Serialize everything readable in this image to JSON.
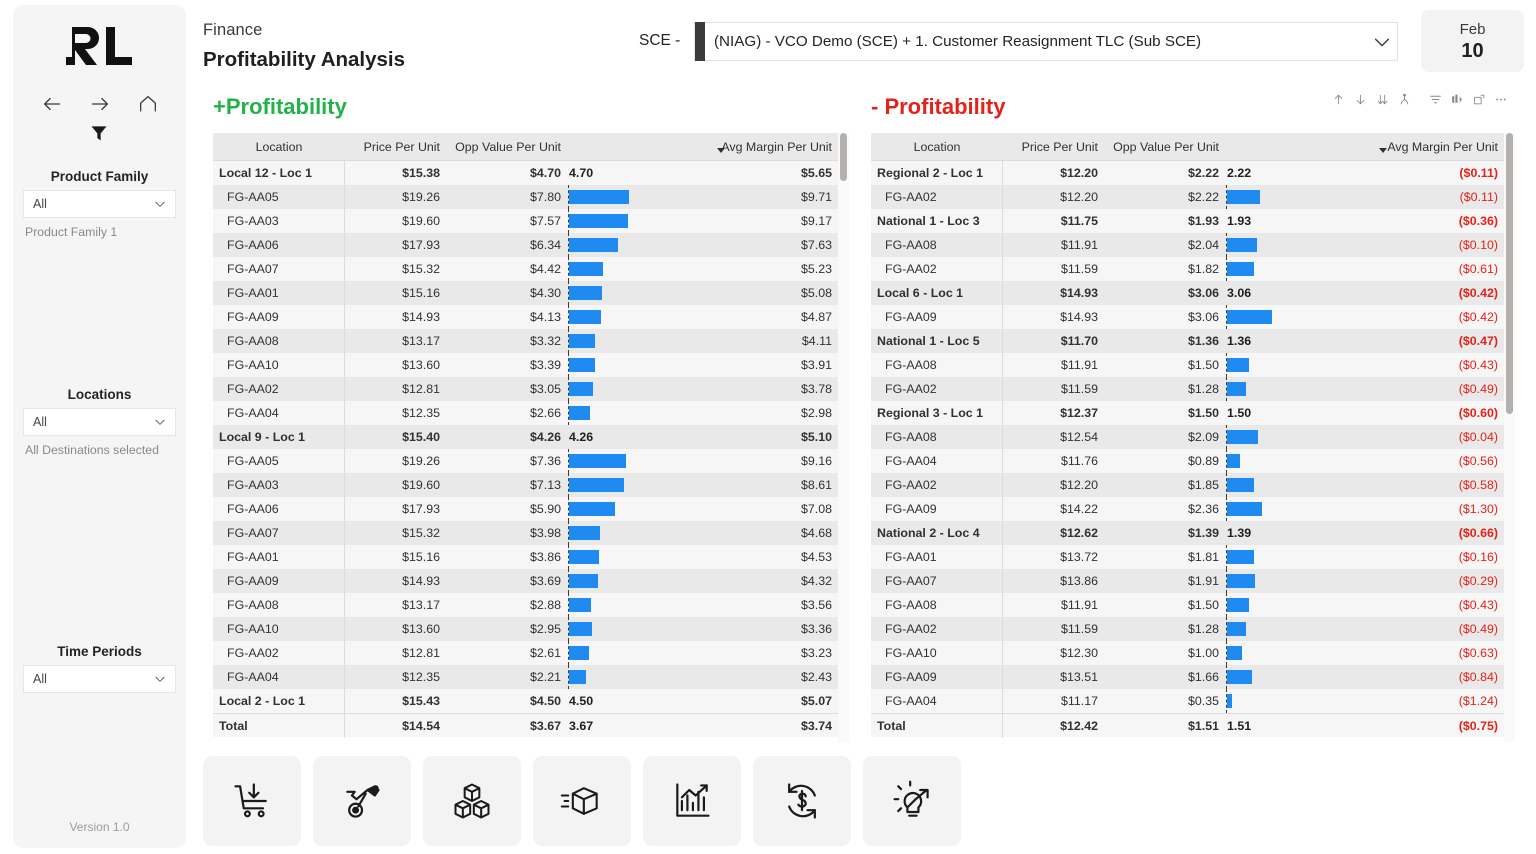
{
  "sidebar": {
    "logo_name": "rl-logo",
    "nav": [
      {
        "name": "back-icon",
        "label": "Back"
      },
      {
        "name": "forward-icon",
        "label": "Forward"
      },
      {
        "name": "home-icon",
        "label": "Home"
      }
    ],
    "filter_icon_label": "Filter",
    "slicers": [
      {
        "title": "Product Family",
        "value": "All",
        "sub": "Product Family 1"
      },
      {
        "title": "Locations",
        "value": "All",
        "sub": "All Destinations selected"
      },
      {
        "title": "Time Periods",
        "value": "All",
        "sub": ""
      }
    ],
    "version": "Version 1.0"
  },
  "header": {
    "category": "Finance",
    "title": "Profitability Analysis",
    "scenario_label": "SCE -",
    "scenario_value": "(NIAG) - VCO Demo (SCE) + 1. Customer Reasignment TLC (Sub SCE)",
    "date_month": "Feb",
    "date_day": "10"
  },
  "viz_toolbar": [
    {
      "name": "sort-ascending-icon"
    },
    {
      "name": "sort-descending-icon"
    },
    {
      "name": "drill-down-icon"
    },
    {
      "name": "expand-hierarchy-icon"
    },
    {
      "name": "filter-icon"
    },
    {
      "name": "focus-mode-icon"
    },
    {
      "name": "expand-icon"
    },
    {
      "name": "more-options-icon"
    }
  ],
  "colors": {
    "positive": "#21b34a",
    "negative": "#e2231a",
    "bar": "#1f8bf0",
    "header_bg": "#e9e9e9"
  },
  "columns": [
    "Location",
    "Price Per Unit",
    "Opp Value Per Unit",
    "",
    "Avg Margin Per Unit"
  ],
  "panels": [
    {
      "title": "+Profitability",
      "tone": "pos",
      "bar_max": 8.0,
      "rows": [
        {
          "type": "group",
          "location": "Local 12 - Loc 1",
          "ppu": "$15.38",
          "opv": "$4.70",
          "bar_label": "4.70",
          "amp": "$5.65",
          "neg": false
        },
        {
          "type": "item",
          "location": "FG-AA05",
          "ppu": "$19.26",
          "opv": "$7.80",
          "bar": 7.8,
          "amp": "$9.71",
          "neg": false
        },
        {
          "type": "item",
          "location": "FG-AA03",
          "ppu": "$19.60",
          "opv": "$7.57",
          "bar": 7.57,
          "amp": "$9.17",
          "neg": false
        },
        {
          "type": "item",
          "location": "FG-AA06",
          "ppu": "$17.93",
          "opv": "$6.34",
          "bar": 6.34,
          "amp": "$7.63",
          "neg": false
        },
        {
          "type": "item",
          "location": "FG-AA07",
          "ppu": "$15.32",
          "opv": "$4.42",
          "bar": 4.42,
          "amp": "$5.23",
          "neg": false
        },
        {
          "type": "item",
          "location": "FG-AA01",
          "ppu": "$15.16",
          "opv": "$4.30",
          "bar": 4.3,
          "amp": "$5.08",
          "neg": false
        },
        {
          "type": "item",
          "location": "FG-AA09",
          "ppu": "$14.93",
          "opv": "$4.13",
          "bar": 4.13,
          "amp": "$4.87",
          "neg": false
        },
        {
          "type": "item",
          "location": "FG-AA08",
          "ppu": "$13.17",
          "opv": "$3.32",
          "bar": 3.32,
          "amp": "$4.11",
          "neg": false
        },
        {
          "type": "item",
          "location": "FG-AA10",
          "ppu": "$13.60",
          "opv": "$3.39",
          "bar": 3.39,
          "amp": "$3.91",
          "neg": false
        },
        {
          "type": "item",
          "location": "FG-AA02",
          "ppu": "$12.81",
          "opv": "$3.05",
          "bar": 3.05,
          "amp": "$3.78",
          "neg": false
        },
        {
          "type": "item",
          "location": "FG-AA04",
          "ppu": "$12.35",
          "opv": "$2.66",
          "bar": 2.66,
          "amp": "$2.98",
          "neg": false
        },
        {
          "type": "group",
          "location": "Local 9 - Loc 1",
          "ppu": "$15.40",
          "opv": "$4.26",
          "bar_label": "4.26",
          "amp": "$5.10",
          "neg": false
        },
        {
          "type": "item",
          "location": "FG-AA05",
          "ppu": "$19.26",
          "opv": "$7.36",
          "bar": 7.36,
          "amp": "$9.16",
          "neg": false
        },
        {
          "type": "item",
          "location": "FG-AA03",
          "ppu": "$19.60",
          "opv": "$7.13",
          "bar": 7.13,
          "amp": "$8.61",
          "neg": false
        },
        {
          "type": "item",
          "location": "FG-AA06",
          "ppu": "$17.93",
          "opv": "$5.90",
          "bar": 5.9,
          "amp": "$7.08",
          "neg": false
        },
        {
          "type": "item",
          "location": "FG-AA07",
          "ppu": "$15.32",
          "opv": "$3.98",
          "bar": 3.98,
          "amp": "$4.68",
          "neg": false
        },
        {
          "type": "item",
          "location": "FG-AA01",
          "ppu": "$15.16",
          "opv": "$3.86",
          "bar": 3.86,
          "amp": "$4.53",
          "neg": false
        },
        {
          "type": "item",
          "location": "FG-AA09",
          "ppu": "$14.93",
          "opv": "$3.69",
          "bar": 3.69,
          "amp": "$4.32",
          "neg": false
        },
        {
          "type": "item",
          "location": "FG-AA08",
          "ppu": "$13.17",
          "opv": "$2.88",
          "bar": 2.88,
          "amp": "$3.56",
          "neg": false
        },
        {
          "type": "item",
          "location": "FG-AA10",
          "ppu": "$13.60",
          "opv": "$2.95",
          "bar": 2.95,
          "amp": "$3.36",
          "neg": false
        },
        {
          "type": "item",
          "location": "FG-AA02",
          "ppu": "$12.81",
          "opv": "$2.61",
          "bar": 2.61,
          "amp": "$3.23",
          "neg": false
        },
        {
          "type": "item",
          "location": "FG-AA04",
          "ppu": "$12.35",
          "opv": "$2.21",
          "bar": 2.21,
          "amp": "$2.43",
          "neg": false
        },
        {
          "type": "group",
          "location": "Local 2 - Loc 1",
          "ppu": "$15.43",
          "opv": "$4.50",
          "bar_label": "4.50",
          "amp": "$5.07",
          "neg": false
        },
        {
          "type": "total",
          "location": "Total",
          "ppu": "$14.54",
          "opv": "$3.67",
          "bar_label": "3.67",
          "amp": "$3.74",
          "neg": false
        }
      ],
      "scroll": {
        "thumb_top": 0,
        "thumb_height": 48
      }
    },
    {
      "title": "- Profitability",
      "tone": "neg",
      "bar_max": 4.2,
      "rows": [
        {
          "type": "group",
          "location": "Regional 2 - Loc 1",
          "ppu": "$12.20",
          "opv": "$2.22",
          "bar_label": "2.22",
          "amp": "($0.11)",
          "neg": true
        },
        {
          "type": "item",
          "location": "FG-AA02",
          "ppu": "$12.20",
          "opv": "$2.22",
          "bar": 2.22,
          "amp": "($0.11)",
          "neg": true
        },
        {
          "type": "group",
          "location": "National 1 - Loc 3",
          "ppu": "$11.75",
          "opv": "$1.93",
          "bar_label": "1.93",
          "amp": "($0.36)",
          "neg": true
        },
        {
          "type": "item",
          "location": "FG-AA08",
          "ppu": "$11.91",
          "opv": "$2.04",
          "bar": 2.04,
          "amp": "($0.10)",
          "neg": true
        },
        {
          "type": "item",
          "location": "FG-AA02",
          "ppu": "$11.59",
          "opv": "$1.82",
          "bar": 1.82,
          "amp": "($0.61)",
          "neg": true
        },
        {
          "type": "group",
          "location": "Local 6 - Loc 1",
          "ppu": "$14.93",
          "opv": "$3.06",
          "bar_label": "3.06",
          "amp": "($0.42)",
          "neg": true
        },
        {
          "type": "item",
          "location": "FG-AA09",
          "ppu": "$14.93",
          "opv": "$3.06",
          "bar": 3.06,
          "amp": "($0.42)",
          "neg": true
        },
        {
          "type": "group",
          "location": "National 1 - Loc 5",
          "ppu": "$11.70",
          "opv": "$1.36",
          "bar_label": "1.36",
          "amp": "($0.47)",
          "neg": true
        },
        {
          "type": "item",
          "location": "FG-AA08",
          "ppu": "$11.91",
          "opv": "$1.50",
          "bar": 1.5,
          "amp": "($0.43)",
          "neg": true
        },
        {
          "type": "item",
          "location": "FG-AA02",
          "ppu": "$11.59",
          "opv": "$1.28",
          "bar": 1.28,
          "amp": "($0.49)",
          "neg": true
        },
        {
          "type": "group",
          "location": "Regional 3 - Loc 1",
          "ppu": "$12.37",
          "opv": "$1.50",
          "bar_label": "1.50",
          "amp": "($0.60)",
          "neg": true
        },
        {
          "type": "item",
          "location": "FG-AA08",
          "ppu": "$12.54",
          "opv": "$2.09",
          "bar": 2.09,
          "amp": "($0.04)",
          "neg": true
        },
        {
          "type": "item",
          "location": "FG-AA04",
          "ppu": "$11.76",
          "opv": "$0.89",
          "bar": 0.89,
          "amp": "($0.56)",
          "neg": true
        },
        {
          "type": "item",
          "location": "FG-AA02",
          "ppu": "$12.20",
          "opv": "$1.85",
          "bar": 1.85,
          "amp": "($0.58)",
          "neg": true
        },
        {
          "type": "item",
          "location": "FG-AA09",
          "ppu": "$14.22",
          "opv": "$2.36",
          "bar": 2.36,
          "amp": "($1.30)",
          "neg": true
        },
        {
          "type": "group",
          "location": "National 2 - Loc 4",
          "ppu": "$12.62",
          "opv": "$1.39",
          "bar_label": "1.39",
          "amp": "($0.66)",
          "neg": true
        },
        {
          "type": "item",
          "location": "FG-AA01",
          "ppu": "$13.72",
          "opv": "$1.81",
          "bar": 1.81,
          "amp": "($0.16)",
          "neg": true
        },
        {
          "type": "item",
          "location": "FG-AA07",
          "ppu": "$13.86",
          "opv": "$1.91",
          "bar": 1.91,
          "amp": "($0.29)",
          "neg": true
        },
        {
          "type": "item",
          "location": "FG-AA08",
          "ppu": "$11.91",
          "opv": "$1.50",
          "bar": 1.5,
          "amp": "($0.43)",
          "neg": true
        },
        {
          "type": "item",
          "location": "FG-AA02",
          "ppu": "$11.59",
          "opv": "$1.28",
          "bar": 1.28,
          "amp": "($0.49)",
          "neg": true
        },
        {
          "type": "item",
          "location": "FG-AA10",
          "ppu": "$12.30",
          "opv": "$1.00",
          "bar": 1.0,
          "amp": "($0.63)",
          "neg": true
        },
        {
          "type": "item",
          "location": "FG-AA09",
          "ppu": "$13.51",
          "opv": "$1.66",
          "bar": 1.66,
          "amp": "($0.84)",
          "neg": true
        },
        {
          "type": "item",
          "location": "FG-AA04",
          "ppu": "$11.17",
          "opv": "$0.35",
          "bar": 0.35,
          "amp": "($1.24)",
          "neg": true
        },
        {
          "type": "total",
          "location": "Total",
          "ppu": "$12.42",
          "opv": "$1.51",
          "bar_label": "1.51",
          "amp": "($0.75)",
          "neg": true
        }
      ],
      "scroll": {
        "thumb_top": 0,
        "thumb_height": 281
      }
    }
  ],
  "icon_buttons": [
    {
      "name": "purchase-order-icon",
      "label": "Purchasing"
    },
    {
      "name": "maintenance-icon",
      "label": "Maintenance"
    },
    {
      "name": "inventory-icon",
      "label": "Inventory"
    },
    {
      "name": "shipping-icon",
      "label": "Shipping"
    },
    {
      "name": "analytics-icon",
      "label": "Analytics"
    },
    {
      "name": "cost-cycle-icon",
      "label": "Cost Cycle"
    },
    {
      "name": "insights-icon",
      "label": "Insights"
    }
  ]
}
